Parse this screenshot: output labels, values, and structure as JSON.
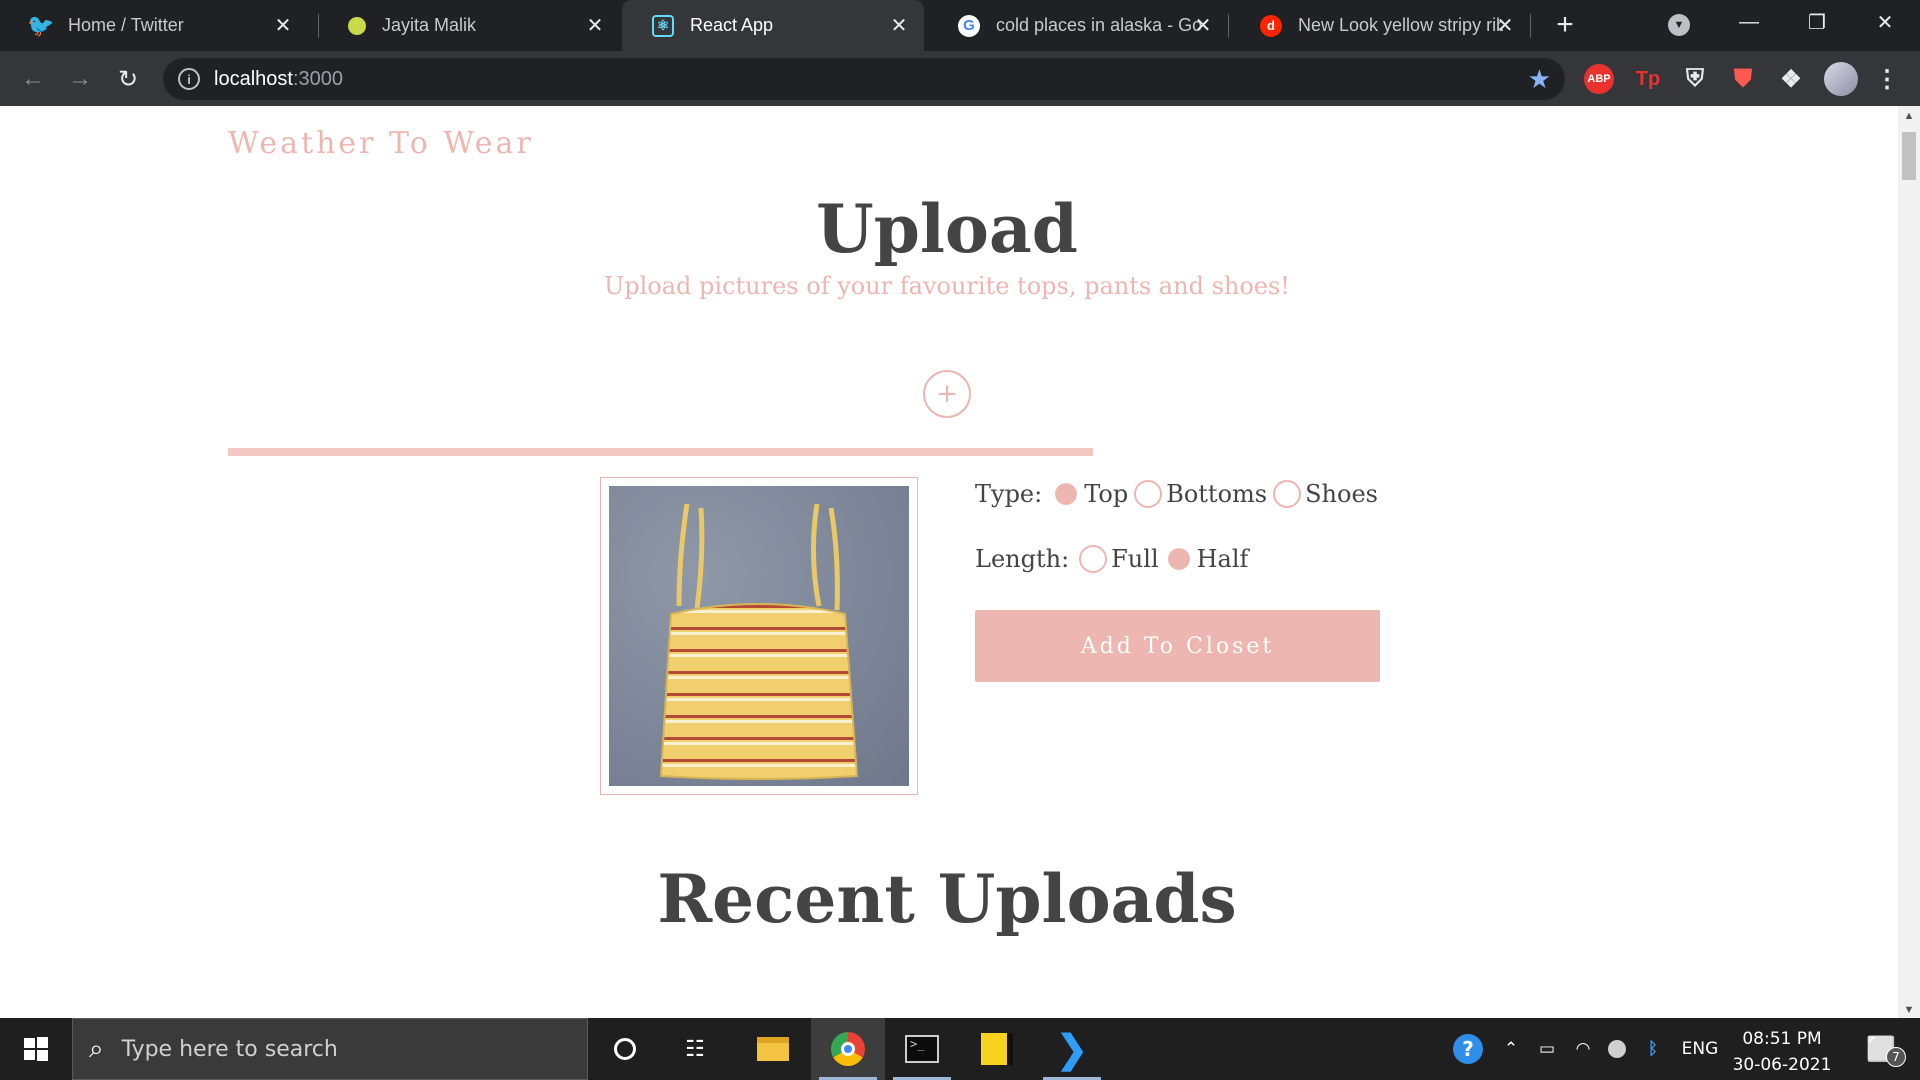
{
  "browser": {
    "tabs": [
      {
        "title": "Home / Twitter",
        "icon": "twitter-icon",
        "active": false
      },
      {
        "title": "Jayita Malik",
        "icon": "ball-icon",
        "active": false
      },
      {
        "title": "React App",
        "icon": "react-icon",
        "active": true
      },
      {
        "title": "cold places in alaska - Google",
        "icon": "google-icon",
        "active": false
      },
      {
        "title": "New Look yellow stripy rib",
        "icon": "depop-icon",
        "active": false
      }
    ],
    "new_tab_symbol": "+",
    "address": {
      "host": "localhost",
      "port": ":3000"
    },
    "extensions": [
      "ABP",
      "Tp"
    ]
  },
  "app": {
    "brand": "Weather To Wear",
    "title": "Upload",
    "subtitle": "Upload pictures of your favourite tops, pants and shoes!",
    "add_symbol": "+",
    "upload_progress": 0.46,
    "type_label": "Type:",
    "type_options": [
      {
        "label": "Top",
        "checked": true
      },
      {
        "label": "Bottoms",
        "checked": false
      },
      {
        "label": "Shoes",
        "checked": false
      }
    ],
    "length_label": "Length:",
    "length_options": [
      {
        "label": "Full",
        "checked": false
      },
      {
        "label": "Half",
        "checked": true
      }
    ],
    "add_to_closet": "Add To Closet",
    "recent_title": "Recent Uploads"
  },
  "taskbar": {
    "search_placeholder": "Type here to search",
    "language": "ENG",
    "time": "08:51 PM",
    "date": "30-06-2021",
    "notification_count": "7"
  },
  "colors": {
    "accent": "#eeb6b0",
    "heading": "#444444",
    "chrome_dark": "#202124",
    "chrome_mid": "#35363a"
  }
}
